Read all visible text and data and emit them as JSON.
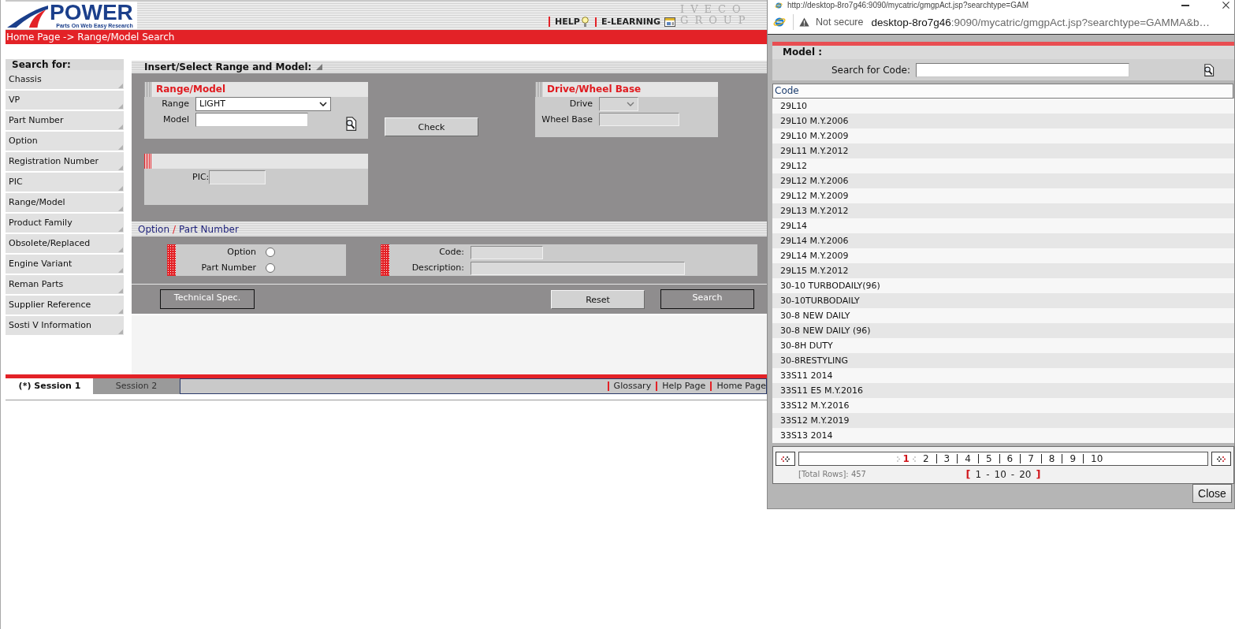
{
  "header": {
    "logo": {
      "wordmark": "POWER",
      "tagline": "Parts On Web Easy Research"
    },
    "links": [
      "HELP",
      "E-LEARNING"
    ],
    "brand": [
      "IVECO",
      "GROUP"
    ]
  },
  "breadcrumb": "Home Page -> Range/Model Search",
  "sidebar": {
    "title": "Search for:",
    "items": [
      "Chassis",
      "VP",
      "Part Number",
      "Option",
      "Registration Number",
      "PIC",
      "Range/Model",
      "Product Family",
      "Obsolete/Replaced",
      "Engine Variant",
      "Reman Parts",
      "Supplier Reference",
      "Sosti V Information"
    ]
  },
  "main": {
    "title": "Insert/Select Range and Model:",
    "range_model": {
      "title": "Range/Model",
      "fields": [
        {
          "kind": "select",
          "label": "Range",
          "value": "LIGHT",
          "disabled": false
        },
        {
          "kind": "input",
          "label": "Model",
          "disabled": false
        }
      ]
    },
    "check_button": {
      "label": "Check",
      "disabled": false
    },
    "drive_wheel_base": {
      "title": "Drive/Wheel Base",
      "fields": [
        {
          "kind": "select",
          "label": "Drive",
          "disabled": true
        },
        {
          "kind": "input",
          "label": "Wheel Base",
          "disabled": true
        }
      ]
    },
    "pic": {
      "fields": [
        {
          "kind": "input",
          "label": "PIC:",
          "disabled": true
        }
      ]
    },
    "option_part": {
      "tabs": [
        "Option",
        "Part Number"
      ],
      "separator": "/",
      "radios": [
        {
          "label": "Option",
          "checked": false
        },
        {
          "label": "Part Number",
          "checked": false
        }
      ],
      "fields": [
        {
          "kind": "input",
          "label": "Code:",
          "disabled": true
        },
        {
          "kind": "input",
          "label": "Description:",
          "disabled": true
        }
      ]
    },
    "buttons": [
      {
        "label": "Technical Spec.",
        "disabled": true
      },
      {
        "label": "Reset",
        "disabled": false
      },
      {
        "label": "Search",
        "disabled": true
      }
    ]
  },
  "sessions": {
    "tabs": [
      {
        "label": "(*) Session 1",
        "selected": true
      },
      {
        "label": "Session 2",
        "selected": false
      }
    ],
    "links": [
      "Glossary",
      "Help Page",
      "Home Page"
    ]
  },
  "popup": {
    "title": "http://desktop-8ro7g46:9090/mycatric/gmgpAct.jsp?searchtype=GAM",
    "address": {
      "security": "Not secure",
      "host": "desktop-8ro7g46",
      "path": ":9090/mycatric/gmgpAct.jsp?searchtype=GAMMA&b…"
    },
    "heading": "Model :",
    "search": {
      "label": "Search for Code:"
    },
    "table": {
      "columns": [
        "Code"
      ],
      "rows": [
        "29L10",
        "29L10 M.Y.2006",
        "29L10 M.Y.2009",
        "29L11 M.Y.2012",
        "29L12",
        "29L12 M.Y.2006",
        "29L12 M.Y.2009",
        "29L13 M.Y.2012",
        "29L14",
        "29L14 M.Y.2006",
        "29L14 M.Y.2009",
        "29L15 M.Y.2012",
        "30-10 TURBODAILY(96)",
        "30-10TURBODAILY",
        "30-8 NEW DAILY",
        "30-8 NEW DAILY (96)",
        "30-8H DUTY",
        "30-8RESTYLING",
        "33S11 2014",
        "33S11 E5 M.Y.2016",
        "33S12 M.Y.2016",
        "33S12 M.Y.2019",
        "33S13 2014"
      ]
    },
    "pager": {
      "pages": [
        {
          "label": "1",
          "selected": true
        },
        {
          "label": "2",
          "selected": false
        },
        {
          "label": "3",
          "selected": false
        },
        {
          "label": "4",
          "selected": false
        },
        {
          "label": "5",
          "selected": false
        },
        {
          "label": "6",
          "selected": false
        },
        {
          "label": "7",
          "selected": false
        },
        {
          "label": "8",
          "selected": false
        },
        {
          "label": "9",
          "selected": false
        },
        {
          "label": "10",
          "selected": false
        }
      ],
      "total": "[Total Rows]: 457",
      "sizes": {
        "open": "[",
        "options": [
          "1",
          "10",
          "20"
        ],
        "separator": "-",
        "close": "]"
      }
    },
    "close_button": "Close"
  }
}
